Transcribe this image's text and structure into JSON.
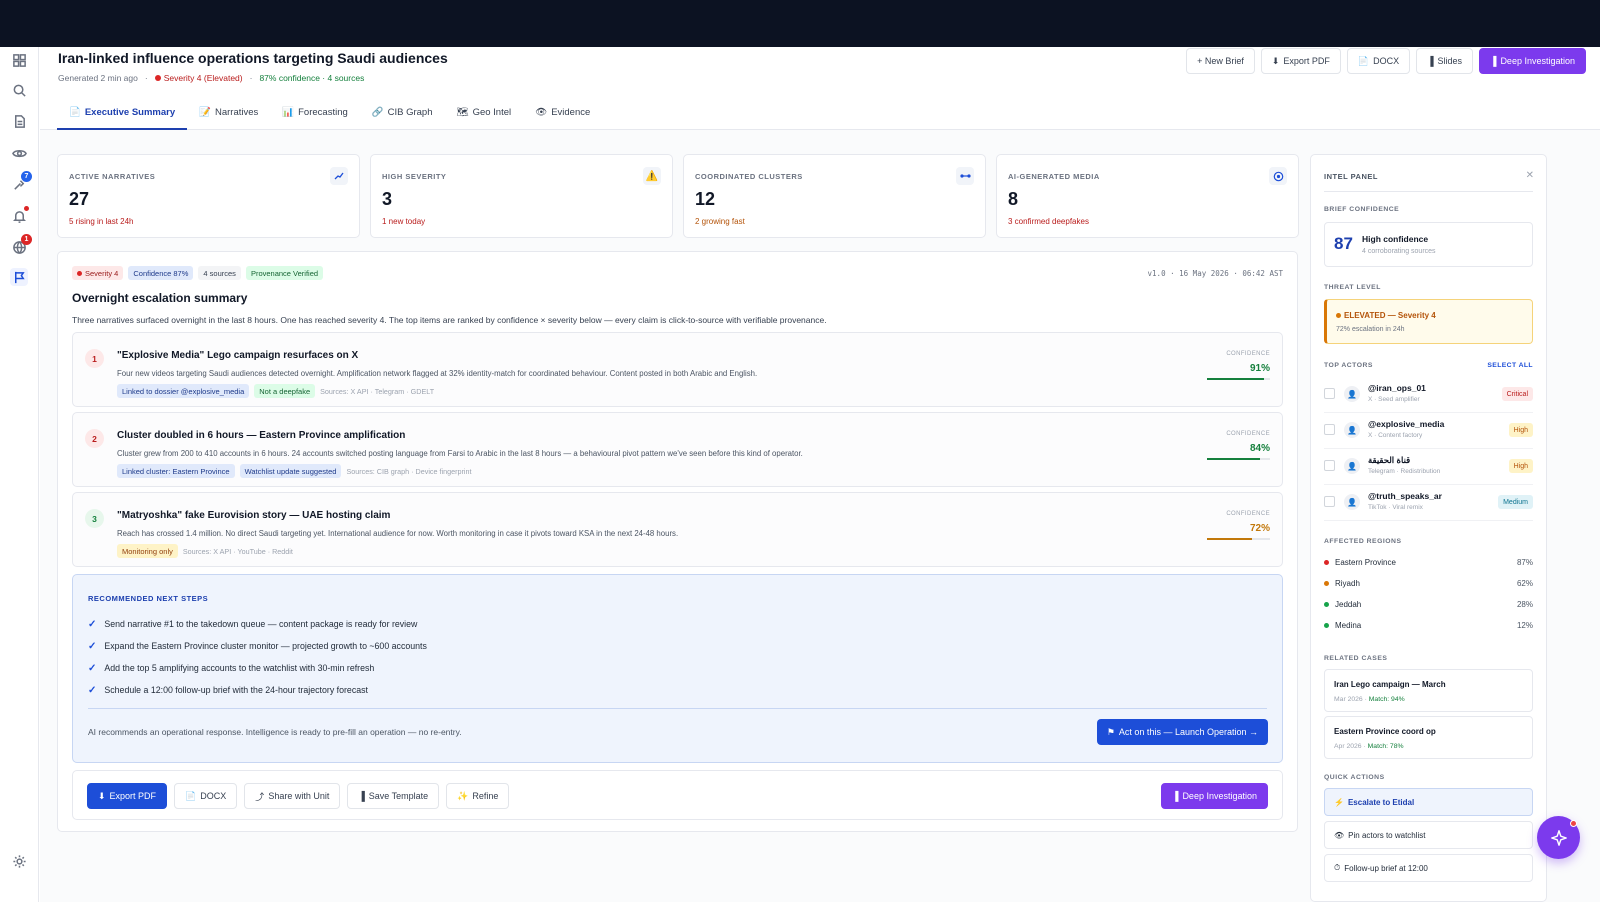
{
  "header": {
    "title": "Iran-linked influence operations targeting Saudi audiences",
    "generated": "Generated 2 min ago",
    "severity": "Severity 4 (Elevated)",
    "confidence": "87% confidence · 4 sources",
    "buttons": {
      "new_brief": "+ New Brief",
      "export_pdf": "Export PDF",
      "docx": "DOCX",
      "slides": "Slides",
      "deep_investigation": "Deep Investigation"
    }
  },
  "tabs": [
    {
      "label": "Executive Summary",
      "icon": "📄"
    },
    {
      "label": "Narratives",
      "icon": "📝"
    },
    {
      "label": "Forecasting",
      "icon": "📊"
    },
    {
      "label": "CIB Graph",
      "icon": "🔗"
    },
    {
      "label": "Geo Intel",
      "icon": "🗺"
    },
    {
      "label": "Evidence",
      "icon": "👁"
    }
  ],
  "rail": {
    "badge_target": "7",
    "badge_globe": "1"
  },
  "kpis": [
    {
      "label": "ACTIVE NARRATIVES",
      "value": "27",
      "sub": "5 rising in last 24h",
      "sub_color": "#b91c1c",
      "icon": "trend-icon"
    },
    {
      "label": "HIGH SEVERITY",
      "value": "3",
      "sub": "1 new today",
      "sub_color": "#b91c1c",
      "icon": "warning-icon"
    },
    {
      "label": "COORDINATED CLUSTERS",
      "value": "12",
      "sub": "2 growing fast",
      "sub_color": "#b45309",
      "icon": "link-icon"
    },
    {
      "label": "AI-GENERATED MEDIA",
      "value": "8",
      "sub": "3 confirmed deepfakes",
      "sub_color": "#b91c1c",
      "icon": "target-icon"
    }
  ],
  "summary": {
    "chips": {
      "severity": "Severity 4",
      "confidence": "Confidence 87%",
      "sources": "4 sources",
      "provenance": "Provenance Verified"
    },
    "version": "v1.0 · 16 May 2026 · 06:42 AST",
    "title": "Overnight escalation summary",
    "description": "Three narratives surfaced overnight in the last 8 hours. One has reached severity 4. The top items are ranked by confidence × severity below — every claim is click-to-source with verifiable provenance.",
    "items": [
      {
        "num": "1",
        "title": "\"Explosive Media\" Lego campaign resurfaces on X",
        "desc": "Four new videos targeting Saudi audiences detected overnight. Amplification network flagged at 32% identity-match for coordinated behaviour. Content posted in both Arabic and English.",
        "tags": [
          {
            "text": "Linked to dossier @explosive_media",
            "kind": "blue"
          },
          {
            "text": "Not a deepfake",
            "kind": "green"
          }
        ],
        "sources": "Sources: X API · Telegram · GDELT",
        "conf_label": "CONFIDENCE",
        "confidence": "91%",
        "conf_value": 0.91,
        "color": "#15803d",
        "num_bg": "#fde8e8",
        "num_color": "#b91c1c"
      },
      {
        "num": "2",
        "title": "Cluster doubled in 6 hours — Eastern Province amplification",
        "desc": "Cluster grew from 200 to 410 accounts in 6 hours. 24 accounts switched posting language from Farsi to Arabic in the last 8 hours — a behavioural pivot pattern we've seen before this kind of operator.",
        "tags": [
          {
            "text": "Linked cluster: Eastern Province",
            "kind": "blue"
          },
          {
            "text": "Watchlist update suggested",
            "kind": "blue"
          }
        ],
        "sources": "Sources: CIB graph · Device fingerprint",
        "conf_label": "CONFIDENCE",
        "confidence": "84%",
        "conf_value": 0.84,
        "color": "#15803d",
        "num_bg": "#fde8e8",
        "num_color": "#b91c1c"
      },
      {
        "num": "3",
        "title": "\"Matryoshka\" fake Eurovision story — UAE hosting claim",
        "desc": "Reach has crossed 1.4 million. No direct Saudi targeting yet. International audience for now. Worth monitoring in case it pivots toward KSA in the next 24-48 hours.",
        "tags": [
          {
            "text": "Monitoring only",
            "kind": "amber"
          }
        ],
        "sources": "Sources: X API · YouTube · Reddit",
        "conf_label": "CONFIDENCE",
        "confidence": "72%",
        "conf_value": 0.72,
        "color": "#c2780a",
        "num_bg": "#e7f7ec",
        "num_color": "#15803d"
      }
    ],
    "next_steps": {
      "heading": "RECOMMENDED NEXT STEPS",
      "steps": [
        "Send narrative #1 to the takedown queue — content package is ready for review",
        "Expand the Eastern Province cluster monitor — projected growth to ~600 accounts",
        "Add the top 5 amplifying accounts to the watchlist with 30-min refresh",
        "Schedule a 12:00 follow-up brief with the 24-hour trajectory forecast"
      ],
      "ai_note": "AI recommends an operational response. Intelligence is ready to pre-fill an operation — no re-entry.",
      "launch": "Act on this — Launch Operation →"
    },
    "actions": {
      "export_pdf": "Export PDF",
      "docx": "DOCX",
      "share": "Share with Unit",
      "template": "Save Template",
      "refine": "Refine",
      "deep": "Deep Investigation"
    }
  },
  "panel": {
    "title": "INTEL PANEL",
    "brief_confidence_label": "BRIEF CONFIDENCE",
    "confidence_value": "87",
    "confidence_text": "High confidence",
    "confidence_sub": "4 corroborating sources",
    "threat_label": "THREAT LEVEL",
    "threat_text": "ELEVATED — Severity 4",
    "threat_sub": "72% escalation in 24h",
    "actors_label": "TOP ACTORS",
    "select_all": "SELECT ALL",
    "actors": [
      {
        "handle": "@iran_ops_01",
        "desc": "X · Seed amplifier",
        "badge": "Critical",
        "bg": "#fde8e8",
        "fg": "#b91c1c"
      },
      {
        "handle": "@explosive_media",
        "desc": "X · Content factory",
        "badge": "High",
        "bg": "#fef3c7",
        "fg": "#b45309"
      },
      {
        "handle": "قناة الحقيقة",
        "desc": "Telegram · Redistribution",
        "badge": "High",
        "bg": "#fef3c7",
        "fg": "#b45309"
      },
      {
        "handle": "@truth_speaks_ar",
        "desc": "TikTok · Viral remix",
        "badge": "Medium",
        "bg": "#e0f2f7",
        "fg": "#0e7490"
      }
    ],
    "regions_label": "AFFECTED REGIONS",
    "regions": [
      {
        "name": "Eastern Province",
        "pct": "87%",
        "color": "#dc2626"
      },
      {
        "name": "Riyadh",
        "pct": "62%",
        "color": "#d97706"
      },
      {
        "name": "Jeddah",
        "pct": "28%",
        "color": "#16a34a"
      },
      {
        "name": "Medina",
        "pct": "12%",
        "color": "#16a34a"
      }
    ],
    "cases_label": "RELATED CASES",
    "cases": [
      {
        "title": "Iran Lego campaign — March",
        "date": "Mar 2026 ·",
        "match": "Match: 94%"
      },
      {
        "title": "Eastern Province coord op",
        "date": "Apr 2026 ·",
        "match": "Match: 78%"
      }
    ],
    "quick_label": "QUICK ACTIONS",
    "quick": [
      {
        "text": "Escalate to Etidal",
        "icon": "⚡"
      },
      {
        "text": "Pin actors to watchlist",
        "icon": "👁"
      },
      {
        "text": "Follow-up brief at 12:00",
        "icon": "⏱"
      }
    ]
  }
}
